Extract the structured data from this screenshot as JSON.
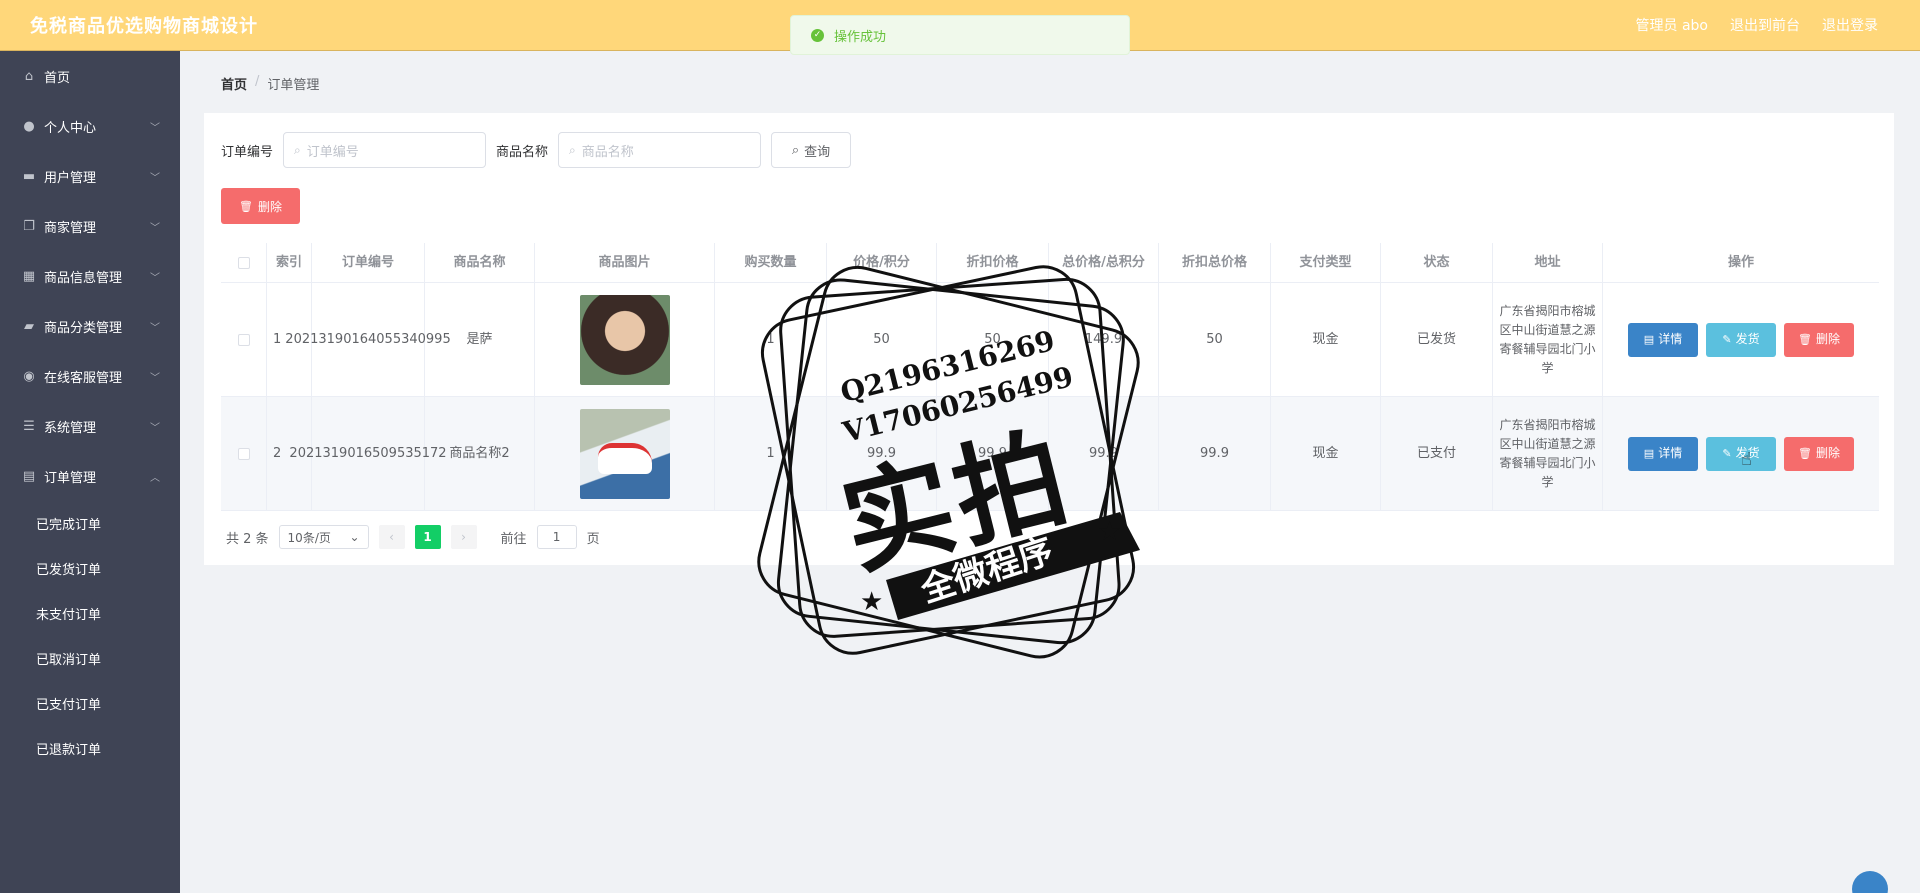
{
  "header": {
    "title": "免税商品优选购物商城设计",
    "user": "管理员 abo",
    "back_front": "退出到前台",
    "logout": "退出登录"
  },
  "toast": {
    "message": "操作成功"
  },
  "sidebar": {
    "items": [
      {
        "label": "首页",
        "icon": "home-icon"
      },
      {
        "label": "个人中心",
        "icon": "user-icon"
      },
      {
        "label": "用户管理",
        "icon": "briefcase-icon"
      },
      {
        "label": "商家管理",
        "icon": "copy-icon"
      },
      {
        "label": "商品信息管理",
        "icon": "grid-icon"
      },
      {
        "label": "商品分类管理",
        "icon": "chat-icon"
      },
      {
        "label": "在线客服管理",
        "icon": "location-icon"
      },
      {
        "label": "系统管理",
        "icon": "list-icon"
      },
      {
        "label": "订单管理",
        "icon": "clipboard-icon"
      }
    ],
    "subitems": [
      "已完成订单",
      "已发货订单",
      "未支付订单",
      "已取消订单",
      "已支付订单",
      "已退款订单"
    ]
  },
  "breadcrumb": {
    "home": "首页",
    "separator": "/",
    "current": "订单管理"
  },
  "search": {
    "order_no_label": "订单编号",
    "order_no_placeholder": "订单编号",
    "goods_name_label": "商品名称",
    "goods_name_placeholder": "商品名称",
    "query_label": "查询"
  },
  "toolbar": {
    "delete_label": "删除"
  },
  "table": {
    "headers": [
      "索引",
      "订单编号",
      "商品名称",
      "商品图片",
      "购买数量",
      "价格/积分",
      "折扣价格",
      "总价格/总积分",
      "折扣总价格",
      "支付类型",
      "状态",
      "地址",
      "操作"
    ],
    "rows": [
      {
        "index": "1",
        "order_no": "20213190164055340995",
        "goods_name": "是萨",
        "qty": "1",
        "price": "50",
        "discount_price": "50",
        "total": "149.9",
        "discount_total": "50",
        "pay_type": "现金",
        "status": "已发货",
        "address": "广东省揭阳市榕城区中山街道慧之源寄餐辅导园北门小学"
      },
      {
        "index": "2",
        "order_no": "2021319016509535172",
        "goods_name": "商品名称2",
        "qty": "1",
        "price": "99.9",
        "discount_price": "99.9",
        "total": "99.9",
        "discount_total": "99.9",
        "pay_type": "现金",
        "status": "已支付",
        "address": "广东省揭阳市榕城区中山街道慧之源寄餐辅导园北门小学"
      }
    ],
    "actions": {
      "detail": "详情",
      "ship": "发货",
      "delete": "删除"
    }
  },
  "pagination": {
    "total": "共 2 条",
    "page_size": "10条/页",
    "current_page": "1",
    "goto_prefix": "前往",
    "goto_value": "1",
    "goto_suffix": "页"
  },
  "watermark": {
    "line1": "Q2196316269",
    "line2": "V17060256499",
    "big": "实拍",
    "banner": "全微程序"
  }
}
